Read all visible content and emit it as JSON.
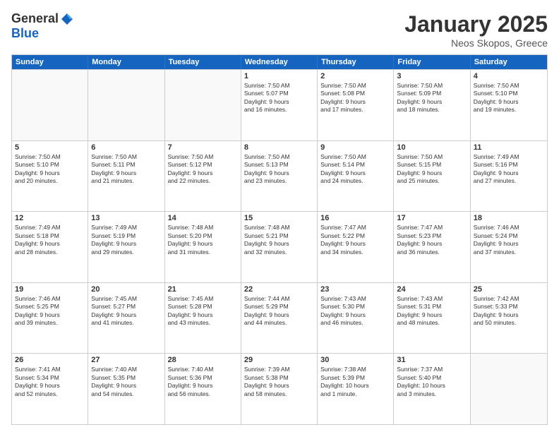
{
  "logo": {
    "general": "General",
    "blue": "Blue"
  },
  "title": "January 2025",
  "location": "Neos Skopos, Greece",
  "weekdays": [
    "Sunday",
    "Monday",
    "Tuesday",
    "Wednesday",
    "Thursday",
    "Friday",
    "Saturday"
  ],
  "rows": [
    [
      {
        "day": "",
        "info": ""
      },
      {
        "day": "",
        "info": ""
      },
      {
        "day": "",
        "info": ""
      },
      {
        "day": "1",
        "info": "Sunrise: 7:50 AM\nSunset: 5:07 PM\nDaylight: 9 hours\nand 16 minutes."
      },
      {
        "day": "2",
        "info": "Sunrise: 7:50 AM\nSunset: 5:08 PM\nDaylight: 9 hours\nand 17 minutes."
      },
      {
        "day": "3",
        "info": "Sunrise: 7:50 AM\nSunset: 5:09 PM\nDaylight: 9 hours\nand 18 minutes."
      },
      {
        "day": "4",
        "info": "Sunrise: 7:50 AM\nSunset: 5:10 PM\nDaylight: 9 hours\nand 19 minutes."
      }
    ],
    [
      {
        "day": "5",
        "info": "Sunrise: 7:50 AM\nSunset: 5:10 PM\nDaylight: 9 hours\nand 20 minutes."
      },
      {
        "day": "6",
        "info": "Sunrise: 7:50 AM\nSunset: 5:11 PM\nDaylight: 9 hours\nand 21 minutes."
      },
      {
        "day": "7",
        "info": "Sunrise: 7:50 AM\nSunset: 5:12 PM\nDaylight: 9 hours\nand 22 minutes."
      },
      {
        "day": "8",
        "info": "Sunrise: 7:50 AM\nSunset: 5:13 PM\nDaylight: 9 hours\nand 23 minutes."
      },
      {
        "day": "9",
        "info": "Sunrise: 7:50 AM\nSunset: 5:14 PM\nDaylight: 9 hours\nand 24 minutes."
      },
      {
        "day": "10",
        "info": "Sunrise: 7:50 AM\nSunset: 5:15 PM\nDaylight: 9 hours\nand 25 minutes."
      },
      {
        "day": "11",
        "info": "Sunrise: 7:49 AM\nSunset: 5:16 PM\nDaylight: 9 hours\nand 27 minutes."
      }
    ],
    [
      {
        "day": "12",
        "info": "Sunrise: 7:49 AM\nSunset: 5:18 PM\nDaylight: 9 hours\nand 28 minutes."
      },
      {
        "day": "13",
        "info": "Sunrise: 7:49 AM\nSunset: 5:19 PM\nDaylight: 9 hours\nand 29 minutes."
      },
      {
        "day": "14",
        "info": "Sunrise: 7:48 AM\nSunset: 5:20 PM\nDaylight: 9 hours\nand 31 minutes."
      },
      {
        "day": "15",
        "info": "Sunrise: 7:48 AM\nSunset: 5:21 PM\nDaylight: 9 hours\nand 32 minutes."
      },
      {
        "day": "16",
        "info": "Sunrise: 7:47 AM\nSunset: 5:22 PM\nDaylight: 9 hours\nand 34 minutes."
      },
      {
        "day": "17",
        "info": "Sunrise: 7:47 AM\nSunset: 5:23 PM\nDaylight: 9 hours\nand 36 minutes."
      },
      {
        "day": "18",
        "info": "Sunrise: 7:46 AM\nSunset: 5:24 PM\nDaylight: 9 hours\nand 37 minutes."
      }
    ],
    [
      {
        "day": "19",
        "info": "Sunrise: 7:46 AM\nSunset: 5:25 PM\nDaylight: 9 hours\nand 39 minutes."
      },
      {
        "day": "20",
        "info": "Sunrise: 7:45 AM\nSunset: 5:27 PM\nDaylight: 9 hours\nand 41 minutes."
      },
      {
        "day": "21",
        "info": "Sunrise: 7:45 AM\nSunset: 5:28 PM\nDaylight: 9 hours\nand 43 minutes."
      },
      {
        "day": "22",
        "info": "Sunrise: 7:44 AM\nSunset: 5:29 PM\nDaylight: 9 hours\nand 44 minutes."
      },
      {
        "day": "23",
        "info": "Sunrise: 7:43 AM\nSunset: 5:30 PM\nDaylight: 9 hours\nand 46 minutes."
      },
      {
        "day": "24",
        "info": "Sunrise: 7:43 AM\nSunset: 5:31 PM\nDaylight: 9 hours\nand 48 minutes."
      },
      {
        "day": "25",
        "info": "Sunrise: 7:42 AM\nSunset: 5:33 PM\nDaylight: 9 hours\nand 50 minutes."
      }
    ],
    [
      {
        "day": "26",
        "info": "Sunrise: 7:41 AM\nSunset: 5:34 PM\nDaylight: 9 hours\nand 52 minutes."
      },
      {
        "day": "27",
        "info": "Sunrise: 7:40 AM\nSunset: 5:35 PM\nDaylight: 9 hours\nand 54 minutes."
      },
      {
        "day": "28",
        "info": "Sunrise: 7:40 AM\nSunset: 5:36 PM\nDaylight: 9 hours\nand 56 minutes."
      },
      {
        "day": "29",
        "info": "Sunrise: 7:39 AM\nSunset: 5:38 PM\nDaylight: 9 hours\nand 58 minutes."
      },
      {
        "day": "30",
        "info": "Sunrise: 7:38 AM\nSunset: 5:39 PM\nDaylight: 10 hours\nand 1 minute."
      },
      {
        "day": "31",
        "info": "Sunrise: 7:37 AM\nSunset: 5:40 PM\nDaylight: 10 hours\nand 3 minutes."
      },
      {
        "day": "",
        "info": ""
      }
    ]
  ]
}
